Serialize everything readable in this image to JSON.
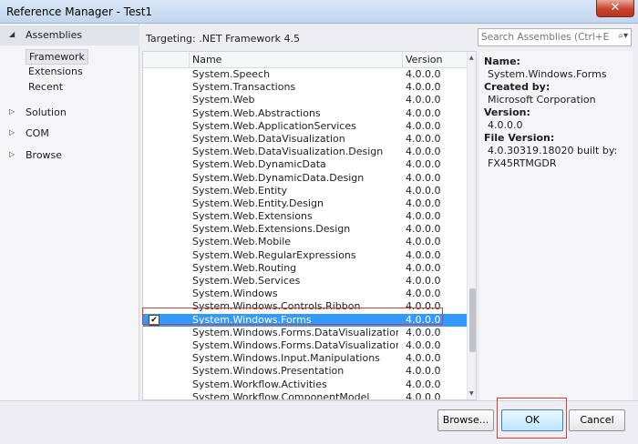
{
  "window": {
    "title": "Reference Manager - Test1",
    "close_glyph": "✕"
  },
  "nav": {
    "assemblies": "Assemblies",
    "framework": "Framework",
    "extensions": "Extensions",
    "recent": "Recent",
    "solution": "Solution",
    "com": "COM",
    "browse": "Browse"
  },
  "header": {
    "targeting": "Targeting: .NET Framework 4.5",
    "search_placeholder": "Search Assemblies (Ctrl+E)"
  },
  "list": {
    "col_name": "Name",
    "col_version": "Version",
    "rows": [
      {
        "name": "System.Speech",
        "version": "4.0.0.0"
      },
      {
        "name": "System.Transactions",
        "version": "4.0.0.0"
      },
      {
        "name": "System.Web",
        "version": "4.0.0.0"
      },
      {
        "name": "System.Web.Abstractions",
        "version": "4.0.0.0"
      },
      {
        "name": "System.Web.ApplicationServices",
        "version": "4.0.0.0"
      },
      {
        "name": "System.Web.DataVisualization",
        "version": "4.0.0.0"
      },
      {
        "name": "System.Web.DataVisualization.Design",
        "version": "4.0.0.0"
      },
      {
        "name": "System.Web.DynamicData",
        "version": "4.0.0.0"
      },
      {
        "name": "System.Web.DynamicData.Design",
        "version": "4.0.0.0"
      },
      {
        "name": "System.Web.Entity",
        "version": "4.0.0.0"
      },
      {
        "name": "System.Web.Entity.Design",
        "version": "4.0.0.0"
      },
      {
        "name": "System.Web.Extensions",
        "version": "4.0.0.0"
      },
      {
        "name": "System.Web.Extensions.Design",
        "version": "4.0.0.0"
      },
      {
        "name": "System.Web.Mobile",
        "version": "4.0.0.0"
      },
      {
        "name": "System.Web.RegularExpressions",
        "version": "4.0.0.0"
      },
      {
        "name": "System.Web.Routing",
        "version": "4.0.0.0"
      },
      {
        "name": "System.Web.Services",
        "version": "4.0.0.0"
      },
      {
        "name": "System.Windows",
        "version": "4.0.0.0"
      },
      {
        "name": "System.Windows.Controls.Ribbon",
        "version": "4.0.0.0"
      },
      {
        "name": "System.Windows.Forms",
        "version": "4.0.0.0"
      },
      {
        "name": "System.Windows.Forms.DataVisualization",
        "version": "4.0.0.0"
      },
      {
        "name": "System.Windows.Forms.DataVisualization.Desi...",
        "version": "4.0.0.0"
      },
      {
        "name": "System.Windows.Input.Manipulations",
        "version": "4.0.0.0"
      },
      {
        "name": "System.Windows.Presentation",
        "version": "4.0.0.0"
      },
      {
        "name": "System.Workflow.Activities",
        "version": "4.0.0.0"
      },
      {
        "name": "System.Workflow.ComponentModel",
        "version": "4.0.0.0"
      }
    ]
  },
  "detail": {
    "name_label": "Name:",
    "name_value": "System.Windows.Forms",
    "created_label": "Created by:",
    "created_value": "Microsoft Corporation",
    "version_label": "Version:",
    "version_value": "4.0.0.0",
    "file_version_label": "File Version:",
    "file_version_value_1": "4.0.30319.18020 built by:",
    "file_version_value_2": "FX45RTMGDR"
  },
  "buttons": {
    "browse": "Browse...",
    "ok": "OK",
    "cancel": "Cancel"
  }
}
